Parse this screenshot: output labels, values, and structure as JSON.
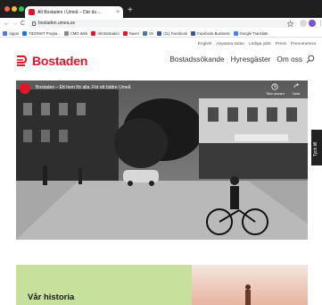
{
  "browser": {
    "tab_title": "Alt Bostaden i Umeå – Där du ...",
    "tab_close": "×",
    "new_tab": "+",
    "url": "bostaden.umea.se",
    "back": "←",
    "forward": "→",
    "reload": "C",
    "bookmarks": [
      {
        "label": "Appar",
        "color": "#4a7bd8"
      },
      {
        "label": "TIDOMAT Progra...",
        "color": "#1a73e8"
      },
      {
        "label": "CMG Web",
        "color": "#888888"
      },
      {
        "label": "AB Bostaden",
        "color": "#e2152b"
      },
      {
        "label": "Navet",
        "color": "#e2152b"
      },
      {
        "label": "VK",
        "color": "#4c75a3"
      },
      {
        "label": "(11) Facebook",
        "color": "#3b5998"
      },
      {
        "label": "Facebook Business",
        "color": "#3b5998"
      },
      {
        "label": "Google Translate",
        "color": "#4285f4"
      }
    ]
  },
  "site": {
    "top_links": [
      "English",
      "Anpassa sidan",
      "Lediga jobb",
      "Press",
      "Prenumerera"
    ],
    "logo_text": "Bostaden",
    "nav": [
      "Bostadssökande",
      "Hyresgäster",
      "Om oss"
    ],
    "hero_caption": "Bostaden – Ett hem för alla. För ett bättre Umeå",
    "hero_ctrl_later": "Titta senare",
    "hero_ctrl_share": "Dela",
    "feedback": "Tyck till",
    "section_title": "Vår historia"
  },
  "colors": {
    "brand": "#e2152b",
    "green": "#c7e09c"
  }
}
